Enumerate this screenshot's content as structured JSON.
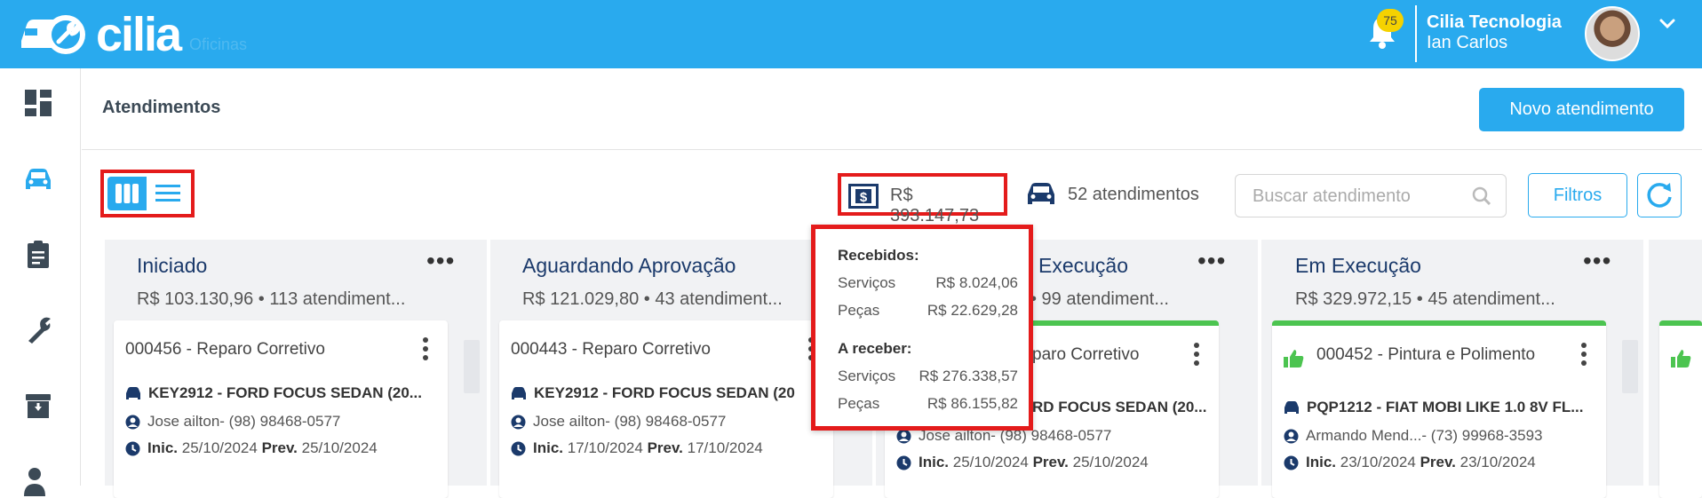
{
  "app": {
    "logo_text": "cilia",
    "logo_subtitle": "Oficinas",
    "notifications_count": "75",
    "user_company": "Cilia Tecnologia",
    "user_name": "Ian Carlos",
    "brand_color": "#29aaee"
  },
  "sidebar": {
    "items": [
      {
        "icon": "dashboard-icon"
      },
      {
        "icon": "car-icon",
        "active": true
      },
      {
        "icon": "clipboard-icon"
      },
      {
        "icon": "wrench-icon"
      },
      {
        "icon": "archive-icon"
      },
      {
        "icon": "add-user-icon"
      }
    ]
  },
  "header": {
    "title": "Atendimentos",
    "new_button": "Novo atendimento"
  },
  "toolbar": {
    "total_value": "R$ 393.147,73",
    "count_text": "52 atendimentos",
    "search_placeholder": "Buscar atendimento",
    "filters_label": "Filtros"
  },
  "popup": {
    "received_title": "Recebidos:",
    "received": [
      {
        "label": "Serviços",
        "value": "R$ 8.024,06"
      },
      {
        "label": "Peças",
        "value": "R$ 22.629,28"
      }
    ],
    "to_receive_title": "A receber:",
    "to_receive": [
      {
        "label": "Serviços",
        "value": "R$ 276.338,57"
      },
      {
        "label": "Peças",
        "value": "R$ 86.155,82"
      }
    ]
  },
  "columns": [
    {
      "title": "Iniciado",
      "summary": "R$ 103.130,96 • 113 atendiment...",
      "card": {
        "title": "000456 - Reparo Corretivo",
        "vehicle": "KEY2912 - FORD FOCUS SEDAN (20...",
        "client": "Jose ailton",
        "phone": " - (98) 98468-0577",
        "start_label": "Inic.",
        "start": "25/10/2024",
        "forecast_label": "Prev.",
        "forecast": "25/10/2024"
      }
    },
    {
      "title": "Aguardando Aprovação",
      "summary": "R$ 121.029,80 • 43 atendiment...",
      "card": {
        "title": "000443 - Reparo Corretivo",
        "vehicle": "KEY2912 - FORD FOCUS SEDAN (20",
        "client": "Jose ailton",
        "phone": " - (98) 98468-0577",
        "start_label": "Inic.",
        "start": "17/10/2024",
        "forecast_label": "Prev.",
        "forecast": "17/10/2024"
      }
    },
    {
      "title": "Execução",
      "summary": "• 99 atendiment...",
      "card": {
        "title": "paro Corretivo",
        "vehicle": "RD FOCUS SEDAN (20...",
        "client": "Jose ailton",
        "phone": " - (98) 98468-0577",
        "start_label": "Inic.",
        "start": "25/10/2024",
        "forecast_label": "Prev.",
        "forecast": "25/10/2024"
      }
    },
    {
      "title": "Em Execução",
      "summary": "R$ 329.972,15 • 45 atendiment...",
      "card": {
        "title": "000452 - Pintura e Polimento",
        "vehicle": "PQP1212 - FIAT MOBI LIKE 1.0 8V FL...",
        "client": "Armando Mend...",
        "phone": " - (73) 99968-3593",
        "start_label": "Inic.",
        "start": "23/10/2024",
        "forecast_label": "Prev.",
        "forecast": "23/10/2024"
      }
    }
  ]
}
